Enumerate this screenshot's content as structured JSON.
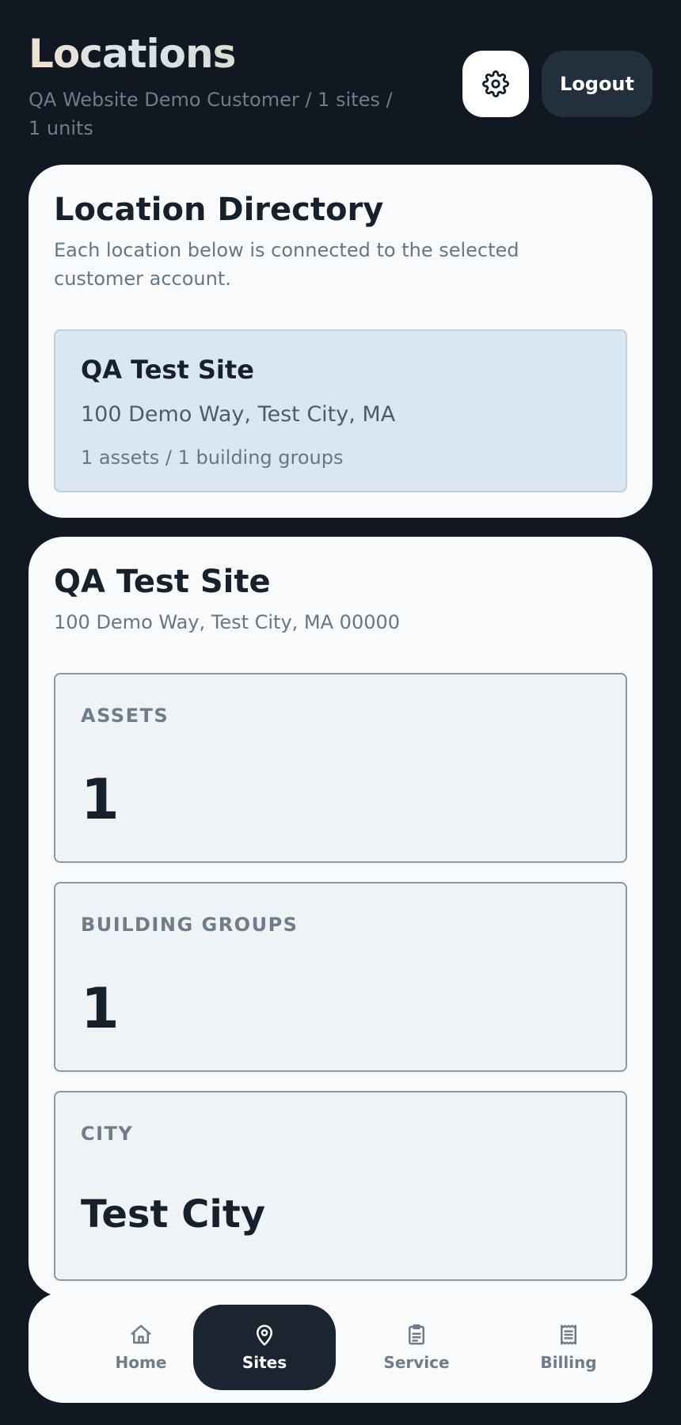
{
  "header": {
    "title": "Locations",
    "subtitle": "QA Website Demo Customer / 1 sites / 1 units",
    "logout_label": "Logout"
  },
  "directory": {
    "title": "Location Directory",
    "description": "Each location below is connected to the selected customer account.",
    "sites": [
      {
        "name": "QA Test Site",
        "address": "100 Demo Way, Test City, MA",
        "meta": "1 assets / 1 building groups"
      }
    ]
  },
  "site_detail": {
    "name": "QA Test Site",
    "address": "100 Demo Way, Test City, MA 00000",
    "stats": [
      {
        "label": "ASSETS",
        "value": "1"
      },
      {
        "label": "BUILDING GROUPS",
        "value": "1"
      },
      {
        "label": "CITY",
        "value": "Test City"
      }
    ]
  },
  "nav": {
    "items": [
      {
        "label": "Home",
        "icon": "home-icon"
      },
      {
        "label": "Sites",
        "icon": "location-pin-icon",
        "active": true
      },
      {
        "label": "Service",
        "icon": "clipboard-icon"
      },
      {
        "label": "Billing",
        "icon": "receipt-icon"
      }
    ]
  },
  "colors": {
    "background": "#111821",
    "card": "#f8fafc",
    "active_nav": "#1b2530",
    "logout": "#22303d"
  }
}
